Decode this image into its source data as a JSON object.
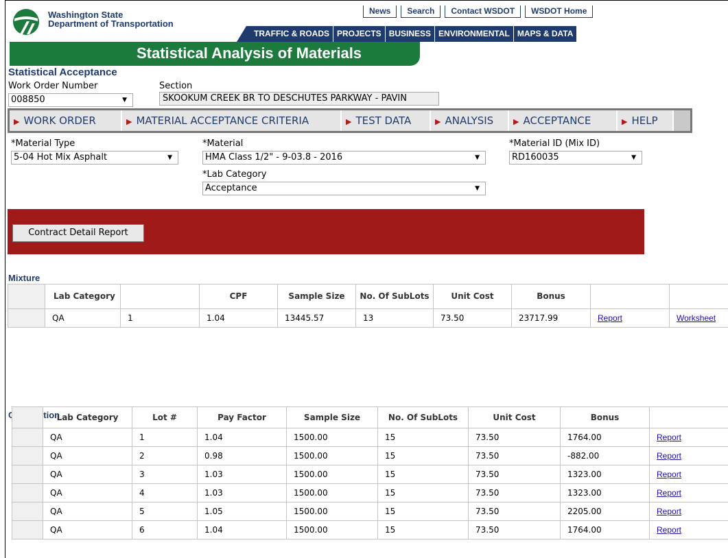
{
  "agency": {
    "line1": "Washington State",
    "line2": "Department of Transportation"
  },
  "top_links": [
    "News",
    "Search",
    "Contact WSDOT",
    "WSDOT Home"
  ],
  "main_nav": [
    "TRAFFIC & ROADS",
    "PROJECTS",
    "BUSINESS",
    "ENVIRONMENTAL",
    "MAPS & DATA"
  ],
  "banner_title": "Statistical Analysis of Materials",
  "page_title": "Statistical Acceptance",
  "work_order": {
    "label": "Work Order Number",
    "value": "008850"
  },
  "section": {
    "label": "Section",
    "value": "SKOOKUM CREEK BR TO DESCHUTES PARKWAY - PAVIN"
  },
  "tabs": [
    "WORK ORDER",
    "MATERIAL ACCEPTANCE CRITERIA",
    "TEST DATA",
    "ANALYSIS",
    "ACCEPTANCE",
    "HELP"
  ],
  "material_type": {
    "label": "*Material Type",
    "value": "5-04 Hot Mix Asphalt"
  },
  "material": {
    "label": "*Material",
    "value": "HMA Class 1/2\" - 9-03.8 - 2016"
  },
  "material_id": {
    "label": "*Material ID (Mix ID)",
    "value": "RD160035"
  },
  "lab_category": {
    "label": "*Lab Category",
    "value": "Acceptance"
  },
  "report_button": "Contract Detail Report",
  "mixture": {
    "title": "Mixture",
    "headers": [
      "Lab Category",
      "",
      "CPF",
      "Sample Size",
      "No. Of SubLots",
      "Unit Cost",
      "Bonus",
      "",
      ""
    ],
    "rows": [
      {
        "lab": "QA",
        "lot": "1",
        "cpf": "1.04",
        "sample": "13445.57",
        "sublots": "13",
        "unit_cost": "73.50",
        "bonus": "23717.99",
        "report": "Report",
        "worksheet": "Worksheet"
      }
    ]
  },
  "compaction": {
    "title": "Compaction",
    "headers": [
      "Lab Category",
      "Lot #",
      "Pay Factor",
      "Sample Size",
      "No. Of SubLots",
      "Unit Cost",
      "Bonus",
      ""
    ],
    "rows": [
      {
        "lab": "QA",
        "lot": "1",
        "pf": "1.04",
        "sample": "1500.00",
        "sublots": "15",
        "unit_cost": "73.50",
        "bonus": "1764.00",
        "report": "Report"
      },
      {
        "lab": "QA",
        "lot": "2",
        "pf": "0.98",
        "sample": "1500.00",
        "sublots": "15",
        "unit_cost": "73.50",
        "bonus": "-882.00",
        "report": "Report"
      },
      {
        "lab": "QA",
        "lot": "3",
        "pf": "1.03",
        "sample": "1500.00",
        "sublots": "15",
        "unit_cost": "73.50",
        "bonus": "1323.00",
        "report": "Report"
      },
      {
        "lab": "QA",
        "lot": "4",
        "pf": "1.03",
        "sample": "1500.00",
        "sublots": "15",
        "unit_cost": "73.50",
        "bonus": "1323.00",
        "report": "Report"
      },
      {
        "lab": "QA",
        "lot": "5",
        "pf": "1.05",
        "sample": "1500.00",
        "sublots": "15",
        "unit_cost": "73.50",
        "bonus": "2205.00",
        "report": "Report"
      },
      {
        "lab": "QA",
        "lot": "6",
        "pf": "1.04",
        "sample": "1500.00",
        "sublots": "15",
        "unit_cost": "73.50",
        "bonus": "1764.00",
        "report": "Report"
      }
    ]
  },
  "colors": {
    "brand_navy": "#1f3b6e",
    "brand_green": "#1d7a3d",
    "alert_red": "#a01a1a",
    "tab_marker": "#b31b1b"
  },
  "icons": {
    "logo": "wsdot-logo-icon",
    "dropdown": "chevron-down-icon",
    "tab_marker": "triangle-right-icon"
  }
}
